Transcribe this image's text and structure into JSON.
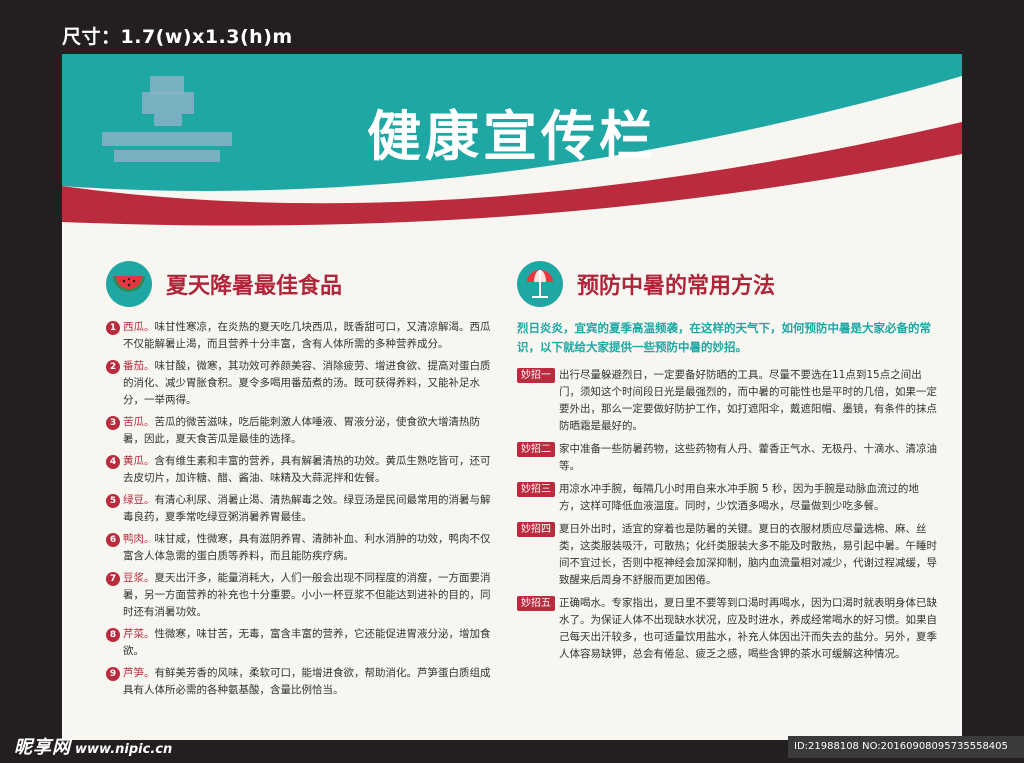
{
  "size_label": "尺寸：1.7(w)x1.3(h)m",
  "title": "健康宣传栏",
  "colors": {
    "teal": "#1fa7a4",
    "red": "#b92b3d",
    "paper": "#f7f6f1",
    "frame": "#231f20"
  },
  "left": {
    "heading": "夏天降暑最佳食品",
    "icon": "watermelon-icon",
    "items": [
      {
        "num": "1",
        "name": "西瓜。",
        "text": "味甘性寒凉，在炎热的夏天吃几块西瓜，既香甜可口，又清凉解渴。西瓜不仅能解暑止渴，而且营养十分丰富，含有人体所需的多种营养成分。"
      },
      {
        "num": "2",
        "name": "番茄。",
        "text": "味甘酸，微寒，其功效可养颜美容、消除疲劳、增进食欲、提高对蛋白质的消化、减少胃胀食积。夏令多喝用番茄煮的汤。既可获得养料，又能补足水分，一举两得。"
      },
      {
        "num": "3",
        "name": "苦瓜。",
        "text": "苦瓜的微苦滋味，吃后能刺激人体唾液、胃液分泌，使食欲大增清热防暑，因此，夏天食苦瓜是最佳的选择。"
      },
      {
        "num": "4",
        "name": "黄瓜。",
        "text": "含有维生素和丰富的营养，具有解暑清热的功效。黄瓜生熟吃皆可，还可去皮切片，加许糖、醋、酱油、味精及大蒜泥拌和佐餐。"
      },
      {
        "num": "5",
        "name": "绿豆。",
        "text": "有清心利尿、消暑止渴、清热解毒之效。绿豆汤是民间最常用的消暑与解毒良药，夏季常吃绿豆粥消暑养胃最佳。"
      },
      {
        "num": "6",
        "name": "鸭肉。",
        "text": "味甘咸，性微寒，具有滋阴养胃、清肺补血、利水消肿的功效，鸭肉不仅富含人体急需的蛋白质等养料，而且能防疾疗病。"
      },
      {
        "num": "7",
        "name": "豆浆。",
        "text": "夏天出汗多，能量消耗大，人们一般会出现不同程度的消瘦，一方面要消暑，另一方面营养的补充也十分重要。小小一杯豆浆不但能达到进补的目的，同时还有消暑功效。"
      },
      {
        "num": "8",
        "name": "芹菜。",
        "text": "性微寒，味甘苦，无毒，富含丰富的营养，它还能促进胃液分泌，增加食欲。"
      },
      {
        "num": "9",
        "name": "芦笋。",
        "text": "有鲜美芳香的风味，柔软可口，能增进食欲，帮助消化。芦笋蛋白质组成具有人体所必需的各种氨基酸，含量比例恰当。"
      }
    ]
  },
  "right": {
    "heading": "预防中暑的常用方法",
    "icon": "umbrella-icon",
    "intro": "烈日炎炎，宜宾的夏季高温频袭，在这样的天气下，如何预防中暑是大家必备的常识，以下就给大家提供一些预防中暑的妙招。",
    "tips": [
      {
        "badge": "妙招一",
        "text": "出行尽量躲避烈日，一定要备好防晒的工具。尽量不要选在11点到15点之间出门，须知这个时间段日光是最强烈的，而中暑的可能性也是平时的几倍，如果一定要外出，那么一定要做好防护工作，如打遮阳伞，戴遮阳帽、墨镜，有条件的抹点防晒霜是最好的。"
      },
      {
        "badge": "妙招二",
        "text": "家中准备一些防暑药物，这些药物有人丹、藿香正气水、无极丹、十滴水、清凉油等。"
      },
      {
        "badge": "妙招三",
        "text": "用凉水冲手腕，每隔几小时用自来水冲手腕 5 秒，因为手腕是动脉血流过的地方，这样可降低血液温度。同时，少饮酒多喝水，尽量做到少吃多餐。"
      },
      {
        "badge": "妙招四",
        "text": "夏日外出时，适宜的穿着也是防暑的关键。夏日的衣服材质应尽量选棉、麻、丝类，这类服装吸汗，可散热；化纤类服装大多不能及时散热，易引起中暑。午睡时间不宜过长，否则中枢神经会加深抑制，脑内血流量相对减少，代谢过程减缓，导致醒来后周身不舒服而更加困倦。"
      },
      {
        "badge": "妙招五",
        "text": "正确喝水。专家指出，夏日里不要等到口渴时再喝水，因为口渴时就表明身体已缺水了。为保证人体不出现缺水状况，应及时进水，养成经常喝水的好习惯。如果自己每天出汗较多，也可适量饮用盐水，补充人体因出汗而失去的盐分。另外，夏季人体容易缺钾，总会有倦怠、疲乏之感，喝些含钾的茶水可缓解这种情况。"
      }
    ]
  },
  "watermark": {
    "cn": "昵享网",
    "url": "www.nipic.cn"
  },
  "id_text": "ID:21988108 NO:20160908095735558405"
}
